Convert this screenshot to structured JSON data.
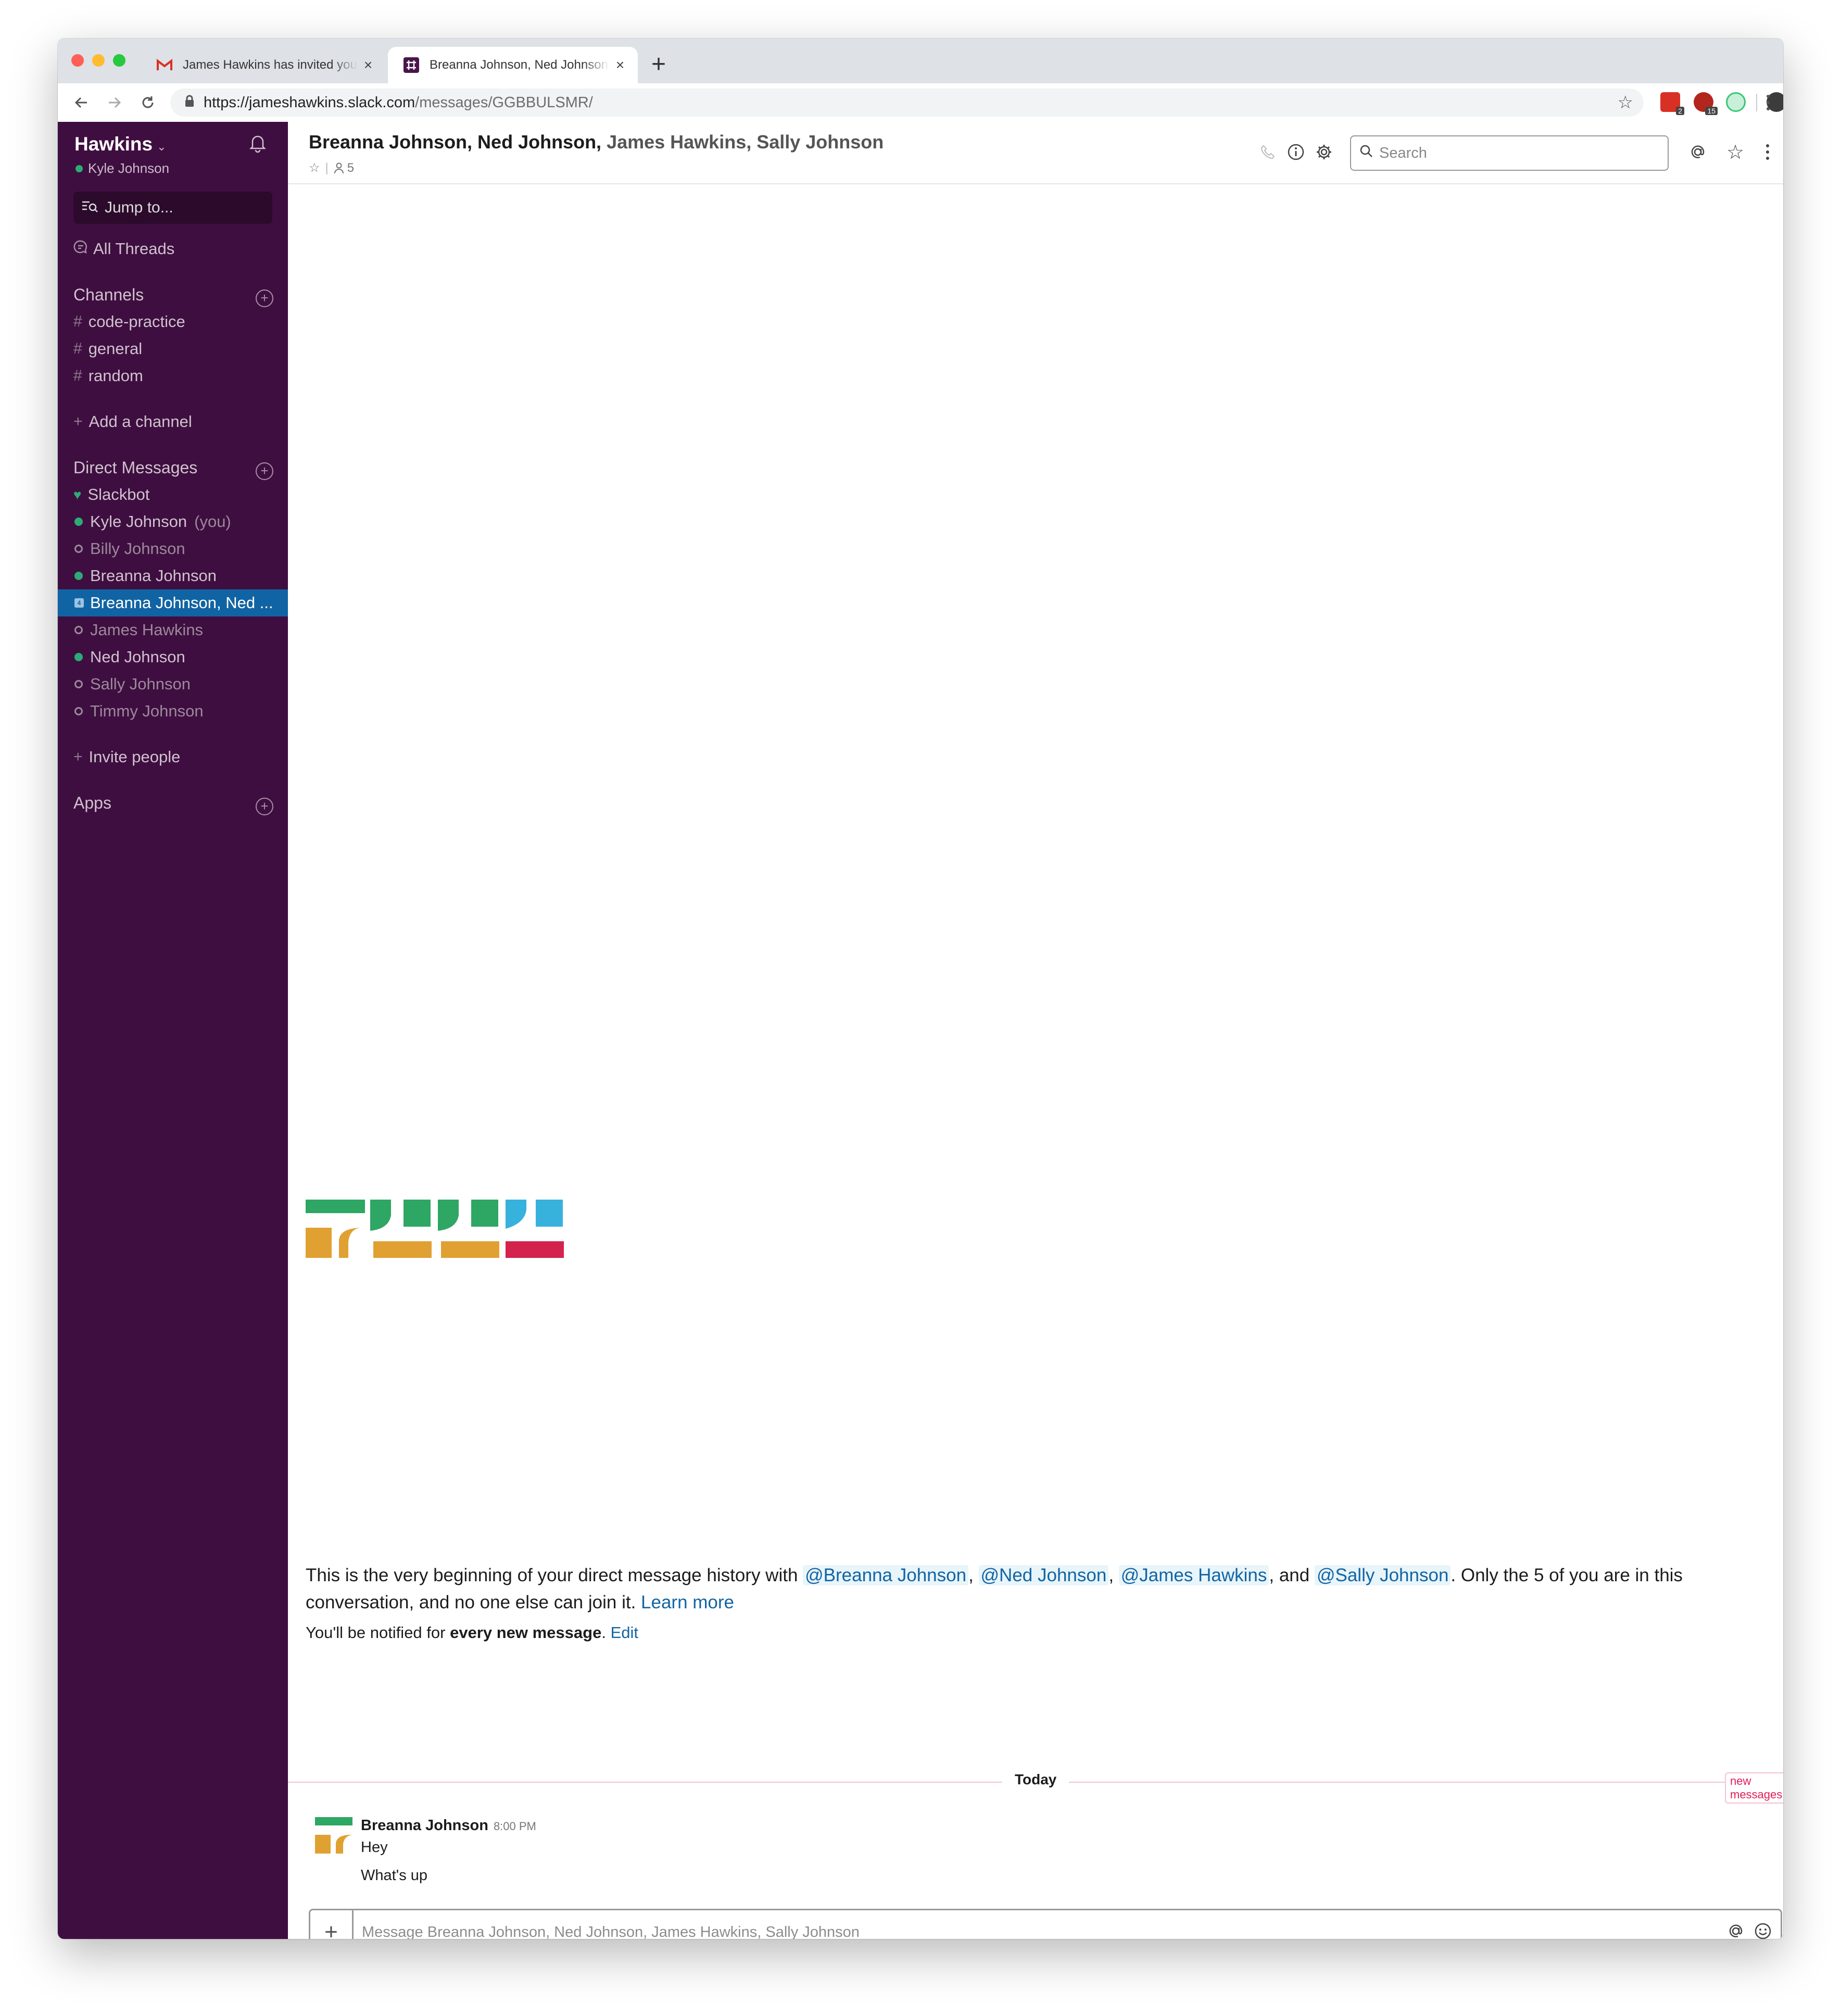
{
  "browser": {
    "tabs": [
      {
        "title": "James Hawkins has invited you",
        "active": false,
        "favicon": "gmail-icon"
      },
      {
        "title": "Breanna Johnson, Ned Johnson",
        "active": true,
        "favicon": "slack-icon"
      }
    ],
    "url": {
      "host": "https://jameshawkins.slack.com",
      "path": "/messages/GGBBULSMR/"
    },
    "extensions": [
      {
        "name": "extension-1-icon",
        "badge": "2"
      },
      {
        "name": "extension-2-icon",
        "badge": "15"
      },
      {
        "name": "extension-3-icon",
        "badge": ""
      }
    ]
  },
  "sidebar": {
    "workspace": "Hawkins",
    "user": "Kyle Johnson",
    "jump_to": "Jump to...",
    "all_threads": "All Threads",
    "channels_header": "Channels",
    "channels": [
      {
        "name": "code-practice"
      },
      {
        "name": "general"
      },
      {
        "name": "random"
      }
    ],
    "add_channel": "Add a channel",
    "dm_header": "Direct Messages",
    "dms": [
      {
        "name": "Slackbot",
        "status": "bot",
        "suffix": ""
      },
      {
        "name": "Kyle Johnson",
        "status": "online",
        "suffix": "(you)"
      },
      {
        "name": "Billy Johnson",
        "status": "away",
        "suffix": ""
      },
      {
        "name": "Breanna Johnson",
        "status": "online",
        "suffix": ""
      },
      {
        "name": "Breanna Johnson, Ned ...",
        "status": "group",
        "suffix": ""
      },
      {
        "name": "James Hawkins",
        "status": "away",
        "suffix": ""
      },
      {
        "name": "Ned Johnson",
        "status": "online",
        "suffix": ""
      },
      {
        "name": "Sally Johnson",
        "status": "away",
        "suffix": ""
      },
      {
        "name": "Timmy Johnson",
        "status": "away",
        "suffix": ""
      }
    ],
    "invite": "Invite people",
    "apps_header": "Apps"
  },
  "channel": {
    "title_bold": "Breanna Johnson, Ned Johnson,",
    "title_rest": " James Hawkins, Sally Johnson",
    "member_count": "5",
    "search_placeholder": "Search"
  },
  "intro": {
    "text_1": "This is the very beginning of your direct message history with ",
    "mentions": [
      "@Breanna Johnson",
      "@Ned Johnson",
      "@James Hawkins",
      "@Sally Johnson"
    ],
    "sep_1": ", ",
    "sep_2": ", ",
    "sep_3": ", and ",
    "text_2": ". Only the 5 of you are in this conversation, and no one else can join it. ",
    "learn_more": "Learn more",
    "notify_prefix": "You'll be notified for ",
    "notify_bold": "every new message",
    "notify_suffix": ". ",
    "edit": "Edit"
  },
  "messages": {
    "divider": "Today",
    "new_messages": "new messages",
    "author": "Breanna Johnson",
    "time": "8:00 PM",
    "lines": [
      "Hey",
      "What's up"
    ]
  },
  "composer": {
    "placeholder": "Message Breanna Johnson, Ned Johnson, James Hawkins, Sally Johnson"
  },
  "colors": {
    "sidebar": "#3f0e40",
    "active_item": "#1164a3",
    "online": "#2bac76",
    "link": "#1264a3",
    "new_messages": "#e01e5a"
  }
}
